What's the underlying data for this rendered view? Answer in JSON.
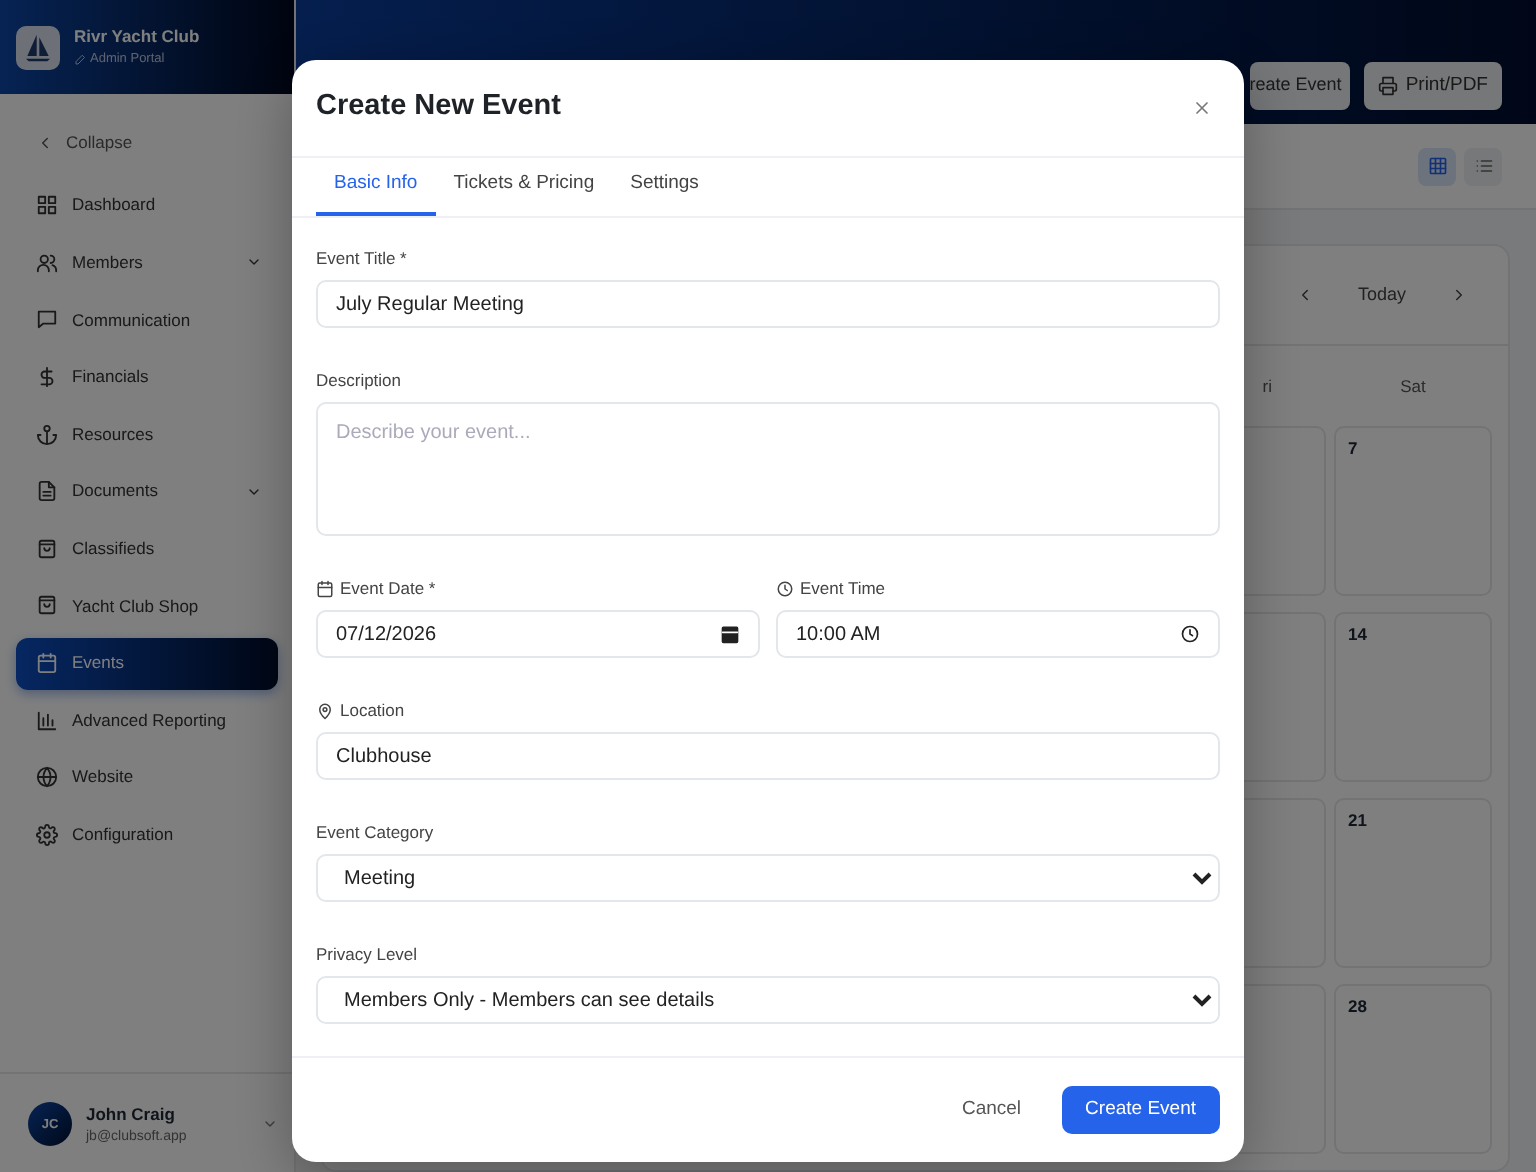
{
  "sidebar": {
    "brand": {
      "name": "Rivr Yacht Club",
      "subtitle": "Admin Portal"
    },
    "collapse": "Collapse",
    "items": [
      {
        "label": "Dashboard",
        "submenu": false,
        "selected": false
      },
      {
        "label": "Members",
        "submenu": true,
        "selected": false
      },
      {
        "label": "Communication",
        "submenu": false,
        "selected": false
      },
      {
        "label": "Financials",
        "submenu": false,
        "selected": false
      },
      {
        "label": "Resources",
        "submenu": false,
        "selected": false
      },
      {
        "label": "Documents",
        "submenu": true,
        "selected": false
      },
      {
        "label": "Classifieds",
        "submenu": false,
        "selected": false
      },
      {
        "label": "Yacht Club Shop",
        "submenu": false,
        "selected": false
      },
      {
        "label": "Events",
        "submenu": false,
        "selected": true
      },
      {
        "label": "Advanced Reporting",
        "submenu": false,
        "selected": false
      },
      {
        "label": "Website",
        "submenu": false,
        "selected": false
      },
      {
        "label": "Configuration",
        "submenu": false,
        "selected": false
      }
    ],
    "user": {
      "initials": "JC",
      "name": "John Craig",
      "email": "jb@clubsoft.app"
    }
  },
  "header": {
    "buttons": [
      {
        "label": "reate Event",
        "kind": "plain"
      },
      {
        "label": "Print/PDF",
        "kind": "print"
      }
    ]
  },
  "view_toggle": [
    {
      "kind": "grid",
      "selected": true
    },
    {
      "kind": "list",
      "selected": false
    }
  ],
  "calendar": {
    "today": "Today",
    "weekdays": [
      "ri",
      "Sat"
    ],
    "weeks": [
      {
        "sat": "7"
      },
      {
        "sat": "14"
      },
      {
        "sat": "21"
      },
      {
        "sat": "28"
      }
    ]
  },
  "modal": {
    "title": "Create New Event",
    "tabs": [
      {
        "label": "Basic Info",
        "selected": true
      },
      {
        "label": "Tickets & Pricing",
        "selected": false
      },
      {
        "label": "Settings",
        "selected": false
      }
    ],
    "fields": [
      {
        "kind": "text",
        "label": "Event Title *",
        "value": "July Regular Meeting"
      },
      {
        "kind": "textarea",
        "label": "Description",
        "placeholder": "Describe your event..."
      },
      {
        "kind": "date",
        "label": "Event Date *",
        "value": "07/12/2026"
      },
      {
        "kind": "time",
        "label": "Event Time",
        "value": "10:00 AM"
      },
      {
        "kind": "location",
        "label": "Location",
        "value": "Clubhouse"
      },
      {
        "kind": "select",
        "label": "Event Category",
        "value": "Meeting"
      },
      {
        "kind": "select",
        "label": "Privacy Level",
        "value": "Members Only - Members can see details"
      }
    ],
    "buttons": [
      {
        "label": "Cancel",
        "kind": "secondary"
      },
      {
        "label": "Create Event",
        "kind": "primary"
      }
    ]
  }
}
